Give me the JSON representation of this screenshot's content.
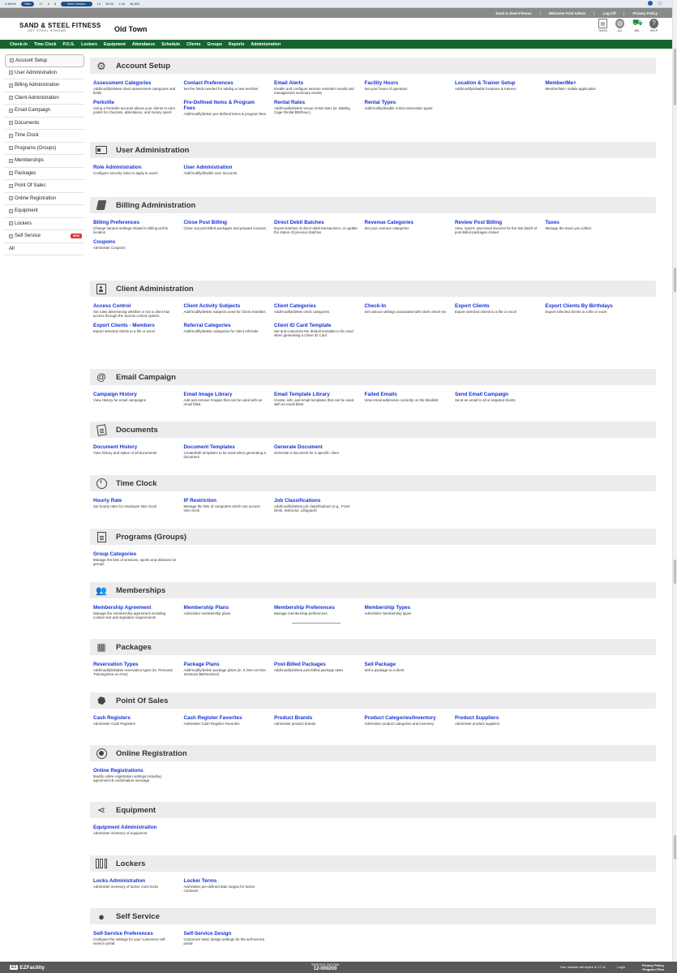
{
  "statusbar": {
    "items": [
      "e-Briefs",
      "Tabs",
      "17",
      "6",
      "8",
      "Best Version",
      "15",
      "36.00",
      "1.06",
      "36,800"
    ]
  },
  "util": {
    "links": [
      "Sand & Steel Fitness",
      "Welcome Fred Admin",
      "Log Off",
      "Privacy Policy"
    ]
  },
  "header": {
    "brand": "SAND & STEEL FITNESS",
    "tagline": "GET STEEL STRONG",
    "location": "Old Town",
    "icons": [
      {
        "name": "clipboard-icon",
        "glyph": "▤",
        "label": "TASKS"
      },
      {
        "name": "globe-icon",
        "glyph": "◍",
        "label": "ALL"
      },
      {
        "name": "basket-icon",
        "glyph": "⛟",
        "label": "BID"
      },
      {
        "name": "help-icon",
        "glyph": "?",
        "label": "HELP"
      }
    ]
  },
  "nav": {
    "items": [
      "Check-In",
      "Time Clock",
      "P.O.S.",
      "Lockers",
      "Equipment",
      "Attendance",
      "Schedule",
      "Clients",
      "Groups",
      "Reports",
      "Administration"
    ]
  },
  "sidebar": {
    "items": [
      {
        "label": "Account Setup",
        "active": true
      },
      {
        "label": "User Administration"
      },
      {
        "label": "Billing Administration"
      },
      {
        "label": "Client Administration"
      },
      {
        "label": "Email Campaign"
      },
      {
        "label": "Documents"
      },
      {
        "label": "Time Clock"
      },
      {
        "label": "Programs (Groups)"
      },
      {
        "label": "Memberships"
      },
      {
        "label": "Packages"
      },
      {
        "label": "Point Of Sales"
      },
      {
        "label": "Online Registration"
      },
      {
        "label": "Equipment"
      },
      {
        "label": "Lockers"
      },
      {
        "label": "Self Service",
        "badge": "NEW"
      }
    ],
    "all_label": "All"
  },
  "sections": [
    {
      "title": "Account Setup",
      "icon": "gears-icon",
      "links": [
        {
          "t": "Assessment Categories",
          "d": "Add/modify/delete client assessment categories and fields"
        },
        {
          "t": "Contact Preferences",
          "d": "Set the fields needed for adding a new member"
        },
        {
          "t": "Email Alerts",
          "d": "Enable and configure session reminder emails and management summary emails"
        },
        {
          "t": "Facility Hours",
          "d": "Set your hours of operation"
        },
        {
          "t": "Location & Trainer Setup",
          "d": "Add/modify/disable locations & trainers"
        },
        {
          "t": "Member/Me+",
          "d": "Member/Me+ mobile application"
        },
        {
          "t": "Perkville",
          "d": "Using a Perkville account allows your clients to earn points for checkins, attendance, and money spent"
        },
        {
          "t": "Pre-Defined Items & Program Fees",
          "d": "Add/modify/delete pre-defined items & program fees"
        },
        {
          "t": "Rental Rates",
          "d": "Add/modify/delete venue rental rates (ie. Batting Cage Rental $50/hour.)"
        },
        {
          "t": "Rental Types",
          "d": "Add/modify/disable rental reservation types"
        }
      ]
    },
    {
      "title": "User Administration",
      "icon": "id-card-icon",
      "links": [
        {
          "t": "Role Administration",
          "d": "Configure security roles to apply to users"
        },
        {
          "t": "User Administration",
          "d": "Add/modify/disable user accounts"
        }
      ]
    },
    {
      "title": "Billing Administration",
      "icon": "book-icon",
      "links": [
        {
          "t": "Billing Preferences",
          "d": "Change various settings related to billing at this location"
        },
        {
          "t": "Close Post Billing",
          "d": "Close out post-billed packages and prepare invoices"
        },
        {
          "t": "Direct Debit Batches",
          "d": "Export batches of direct debit transactions, or update the status of previous batches"
        },
        {
          "t": "Revenue Categories",
          "d": "Set your revenue categories"
        },
        {
          "t": "Review Post Billing",
          "d": "View, reprint, and email invoices for the last batch of post-billed packages closed"
        },
        {
          "t": "Taxes",
          "d": "Manage the taxes you collect"
        },
        {
          "t": "Coupons",
          "d": "Administer Coupons"
        }
      ]
    },
    {
      "title": "Client Administration",
      "icon": "badge-icon",
      "links": [
        {
          "t": "Access Control",
          "d": "Set rules determining whether or not a client has access through the access control system"
        },
        {
          "t": "Client Activity Subjects",
          "d": "Add/modify/delete Subjects used for Client Activities"
        },
        {
          "t": "Client Categories",
          "d": "Add/modify/delete client categories"
        },
        {
          "t": "Check-In",
          "d": "Set various settings associated with client check-ins"
        },
        {
          "t": "Export Clients",
          "d": "Export selected clients to a file or excel"
        },
        {
          "t": "Export Clients By Birthdays",
          "d": "Export selected clients to a file or excel"
        },
        {
          "t": "Export Clients - Members",
          "d": "Export selected clients to a file or excel"
        },
        {
          "t": "Referral Categories",
          "d": "Add/modify/delete categories for client referrals"
        },
        {
          "t": "Client ID Card Template",
          "d": "Set and customize the default template to be used when generating a Client ID Card"
        }
      ]
    },
    {
      "title": "Email Campaign",
      "icon": "at-icon",
      "links": [
        {
          "t": "Campaign History",
          "d": "View History for email campaigns"
        },
        {
          "t": "Email Image Library",
          "d": "Add and remove Images that can be used with an email blast"
        },
        {
          "t": "Email Template Library",
          "d": "Create, edit, and email templates that can be used with an email blast"
        },
        {
          "t": "Failed Emails",
          "d": "View email addresses currently on the blacklist"
        },
        {
          "t": "Send Email Campaign",
          "d": "Send an email to all or targeted clients"
        }
      ]
    },
    {
      "title": "Documents",
      "icon": "documents-icon",
      "links": [
        {
          "t": "Document History",
          "d": "View history and status of all documents"
        },
        {
          "t": "Document Templates",
          "d": "Create/Edit templates to be used when generating a document"
        },
        {
          "t": "Generate Document",
          "d": "Generate a document for a specific client"
        }
      ]
    },
    {
      "title": "Time Clock",
      "icon": "clock-icon",
      "links": [
        {
          "t": "Hourly Rate",
          "d": "Set hourly rates for employee time clock"
        },
        {
          "t": "IP Restriction",
          "d": "Manage the lists of computers which can access time clock"
        },
        {
          "t": "Job Classifications",
          "d": "Add/modify/delete job classifications (e.g., Front Desk, Instructor, Lifeguard)"
        }
      ]
    },
    {
      "title": "Programs (Groups)",
      "icon": "document-icon",
      "links": [
        {
          "t": "Group Categories",
          "d": "Manage the lists of sessions, sports and divisions for groups"
        }
      ]
    },
    {
      "title": "Memberships",
      "icon": "people-icon",
      "links": [
        {
          "t": "Membership Agreement",
          "d": "Manage the membership agreement including custom text and signature requirements"
        },
        {
          "t": "Membership Plans",
          "d": "Administer membership plans"
        },
        {
          "t": "Membership Preferences",
          "d": "Manage membership preferences"
        },
        {
          "t": "Membership Types",
          "d": "Administer membership types"
        }
      ]
    },
    {
      "title": "Packages",
      "icon": "boxes-icon",
      "links": [
        {
          "t": "Reservation Types",
          "d": "Add/modify/disable reservation types (ie. Personal Training/One-on-One)"
        },
        {
          "t": "Package Plans",
          "d": "Add/modify/delete package plans (ie. 5 One-on-One Sessions $60/session)"
        },
        {
          "t": "Post-Billed Packages",
          "d": "Add/modify/delete post-billed package rates"
        },
        {
          "t": "Sell Package",
          "d": "Sell a package to a client"
        }
      ]
    },
    {
      "title": "Point Of Sales",
      "icon": "tag-icon",
      "links": [
        {
          "t": "Cash Registers",
          "d": "Administer Cash Registers"
        },
        {
          "t": "Cash Register Favorites",
          "d": "Administer Cash Register Favorites"
        },
        {
          "t": "Product Brands",
          "d": "Administer product brands"
        },
        {
          "t": "Product Categories/Inventory",
          "d": "Administer product categories and inventory"
        },
        {
          "t": "Product Suppliers",
          "d": "Administer product suppliers"
        }
      ]
    },
    {
      "title": "Online Registration",
      "icon": "target-icon",
      "links": [
        {
          "t": "Online Registrations",
          "d": "Modify online registration settings including agreement & confirmation message"
        }
      ]
    },
    {
      "title": "Equipment",
      "icon": "share-icon",
      "links": [
        {
          "t": "Equipment Administration",
          "d": "Administer inventory of equipment"
        }
      ]
    },
    {
      "title": "Lockers",
      "icon": "lockers-icon",
      "links": [
        {
          "t": "Locks Administration",
          "d": "Administer inventory of locker room locks"
        },
        {
          "t": "Locker Terms",
          "d": "Administer pre-defined date ranges for locker contracts"
        }
      ]
    },
    {
      "title": "Self Service",
      "icon": "person-icon",
      "links": [
        {
          "t": "Self-Service Preferences",
          "d": "Configure the settings for your customers self-service portal"
        },
        {
          "t": "Self-Service Design",
          "d": "Customize basic design settings for the self-service portal"
        }
      ]
    }
  ],
  "footer": {
    "logo": "EZFacility",
    "support_label": "SERVICE 24/7/365",
    "support_phone": "12-000200",
    "session": "Your session will expire in 17:11",
    "signin": "Login",
    "policy1": "Privacy Policy",
    "policy2": "Program Files"
  }
}
